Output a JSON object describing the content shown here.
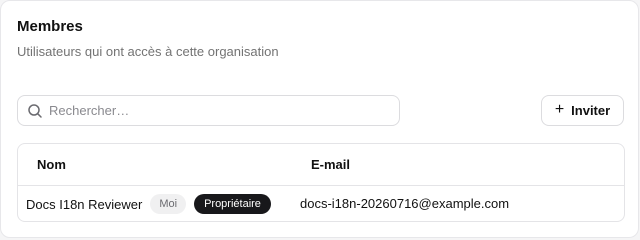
{
  "members": {
    "title": "Membres",
    "subtitle": "Utilisateurs qui ont accès à cette organisation",
    "search": {
      "placeholder": "Rechercher…",
      "value": ""
    },
    "invite_label": "Inviter",
    "table": {
      "columns": [
        "Nom",
        "E-mail"
      ],
      "rows": [
        {
          "name": "Docs I18n Reviewer",
          "badges": [
            "Moi",
            "Propriétaire"
          ],
          "email": "docs-i18n-20260716@example.com"
        }
      ]
    }
  },
  "icons": {
    "search": "search-icon",
    "invite": "plus-icon"
  },
  "colors": {
    "owner_badge_bg": "#18181b",
    "me_badge_bg": "#f0f0f1"
  }
}
